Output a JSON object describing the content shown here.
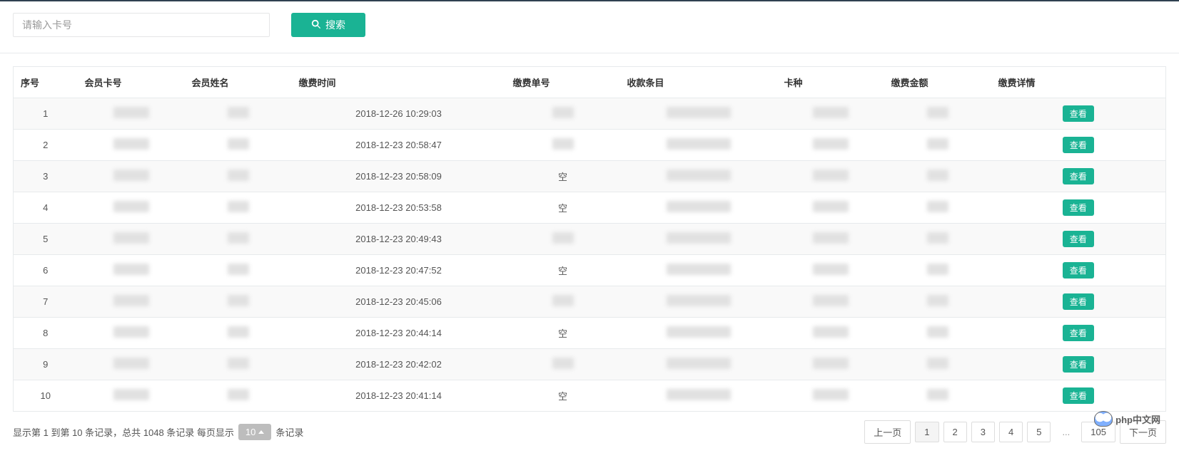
{
  "search": {
    "placeholder": "请输入卡号",
    "button_label": "搜索"
  },
  "table": {
    "headers": {
      "index": "序号",
      "card_no": "会员卡号",
      "member_name": "会员姓名",
      "pay_time": "缴费时间",
      "pay_order": "缴费单号",
      "charge_item": "收款条目",
      "card_type": "卡种",
      "pay_amount": "缴费金额",
      "detail": "缴费详情"
    },
    "rows": [
      {
        "index": "1",
        "pay_time": "2018-12-26 10:29:03",
        "pay_order": "",
        "view": "查看"
      },
      {
        "index": "2",
        "pay_time": "2018-12-23 20:58:47",
        "pay_order": "",
        "view": "查看"
      },
      {
        "index": "3",
        "pay_time": "2018-12-23 20:58:09",
        "pay_order": "空",
        "view": "查看"
      },
      {
        "index": "4",
        "pay_time": "2018-12-23 20:53:58",
        "pay_order": "空",
        "view": "查看"
      },
      {
        "index": "5",
        "pay_time": "2018-12-23 20:49:43",
        "pay_order": "",
        "view": "查看"
      },
      {
        "index": "6",
        "pay_time": "2018-12-23 20:47:52",
        "pay_order": "空",
        "view": "查看"
      },
      {
        "index": "7",
        "pay_time": "2018-12-23 20:45:06",
        "pay_order": "",
        "view": "查看"
      },
      {
        "index": "8",
        "pay_time": "2018-12-23 20:44:14",
        "pay_order": "空",
        "view": "查看"
      },
      {
        "index": "9",
        "pay_time": "2018-12-23 20:42:02",
        "pay_order": "",
        "view": "查看"
      },
      {
        "index": "10",
        "pay_time": "2018-12-23 20:41:14",
        "pay_order": "空",
        "view": "查看"
      }
    ]
  },
  "footer": {
    "info_prefix": "显示第 1 到第 10 条记录，总共 1048 条记录 每页显示",
    "page_size": "10",
    "info_suffix": "条记录"
  },
  "pagination": {
    "prev": "上一页",
    "pages": [
      "1",
      "2",
      "3",
      "4",
      "5"
    ],
    "ellipsis": "...",
    "last": "105",
    "next": "下一页"
  },
  "watermark": "php中文网"
}
